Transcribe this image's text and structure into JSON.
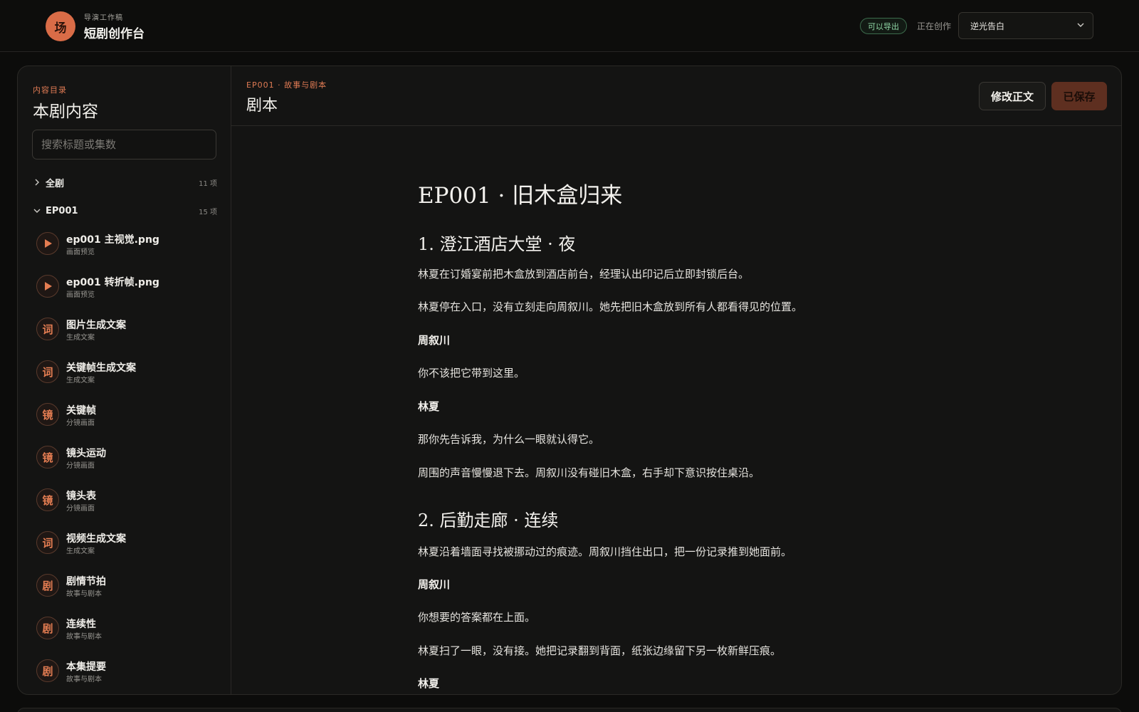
{
  "header": {
    "logo_glyph": "场",
    "subtitle": "导演工作稿",
    "title": "短剧创作台",
    "export_badge": "可以导出",
    "creating_label": "正在创作",
    "project_select_value": "逆光告白"
  },
  "sidebar": {
    "eyebrow": "内容目录",
    "title": "本剧内容",
    "search_placeholder": "搜索标题或集数",
    "groups": [
      {
        "name": "全剧",
        "count": "11 项",
        "expanded": false
      },
      {
        "name": "EP001",
        "count": "15 项",
        "expanded": true
      }
    ],
    "items": [
      {
        "icon": "play-icon",
        "glyph": "",
        "label": "ep001 主视觉.png",
        "sub": "画面预览"
      },
      {
        "icon": "play-icon",
        "glyph": "",
        "label": "ep001 转折帧.png",
        "sub": "画面预览"
      },
      {
        "icon": "word-badge-icon",
        "glyph": "词",
        "label": "图片生成文案",
        "sub": "生成文案"
      },
      {
        "icon": "word-badge-icon",
        "glyph": "词",
        "label": "关键帧生成文案",
        "sub": "生成文案"
      },
      {
        "icon": "shot-badge-icon",
        "glyph": "镜",
        "label": "关键帧",
        "sub": "分镜画面"
      },
      {
        "icon": "shot-badge-icon",
        "glyph": "镜",
        "label": "镜头运动",
        "sub": "分镜画面"
      },
      {
        "icon": "shot-badge-icon",
        "glyph": "镜",
        "label": "镜头表",
        "sub": "分镜画面"
      },
      {
        "icon": "word-badge-icon",
        "glyph": "词",
        "label": "视频生成文案",
        "sub": "生成文案"
      },
      {
        "icon": "drama-badge-icon",
        "glyph": "剧",
        "label": "剧情节拍",
        "sub": "故事与剧本"
      },
      {
        "icon": "drama-badge-icon",
        "glyph": "剧",
        "label": "连续性",
        "sub": "故事与剧本"
      },
      {
        "icon": "drama-badge-icon",
        "glyph": "剧",
        "label": "本集提要",
        "sub": "故事与剧本"
      }
    ]
  },
  "content": {
    "eyebrow": "EP001 · 故事与剧本",
    "title": "剧本",
    "edit_button": "修改正文",
    "saved_button": "已保存",
    "doc_title": "EP001 · 旧木盒归来",
    "scene1_heading": "1. 澄江酒店大堂 · 夜",
    "scene1_p1": "林夏在订婚宴前把木盒放到酒店前台，经理认出印记后立即封锁后台。",
    "scene1_p2": "林夏停在入口，没有立刻走向周叙川。她先把旧木盒放到所有人都看得见的位置。",
    "scene1_speaker1": "周叙川",
    "scene1_line1": "你不该把它带到这里。",
    "scene1_speaker2": "林夏",
    "scene1_line2": "那你先告诉我，为什么一眼就认得它。",
    "scene1_p3": "周围的声音慢慢退下去。周叙川没有碰旧木盒，右手却下意识按住桌沿。",
    "scene2_heading": "2. 后勤走廊 · 连续",
    "scene2_p1": "林夏沿着墙面寻找被挪动过的痕迹。周叙川挡住出口，把一份记录推到她面前。",
    "scene2_speaker1": "周叙川",
    "scene2_line1": "你想要的答案都在上面。",
    "scene2_p2": "林夏扫了一眼，没有接。她把记录翻到背面，纸张边缘留下另一枚新鲜压痕。",
    "scene2_speaker2": "林夏"
  },
  "colors": {
    "accent": "#e07b54",
    "logo_bg": "#d96c47",
    "badge_green": "#8fd6a4",
    "saved_bg": "#5e2f20",
    "background": "#0c0c0b",
    "panel": "#141413"
  }
}
